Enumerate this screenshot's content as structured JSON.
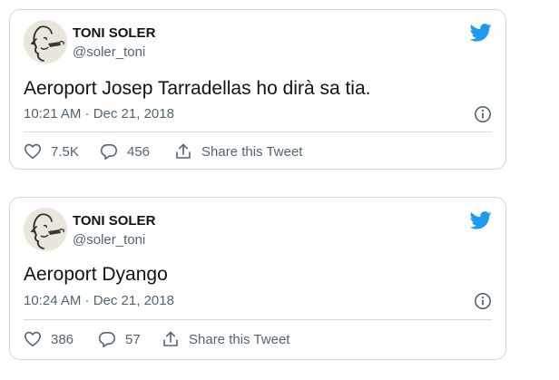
{
  "brand": {
    "accent": "#1d9bf0",
    "text": "#0f1419",
    "muted": "#536471",
    "border": "#cfd9de"
  },
  "tweets": [
    {
      "name": "TONI SOLER",
      "handle": "@soler_toni",
      "text": "Aeroport Josep Tarradellas ho dirà sa tia.",
      "timestamp": "10:21 AM · Dec 21, 2018",
      "likes": "7.5K",
      "replies": "456",
      "share_label": "Share this Tweet"
    },
    {
      "name": "TONI SOLER",
      "handle": "@soler_toni",
      "text": "Aeroport Dyango",
      "timestamp": "10:24 AM · Dec 21, 2018",
      "likes": "386",
      "replies": "57",
      "share_label": "Share this Tweet"
    }
  ],
  "icons": {
    "bird": "twitter-bird-icon",
    "info": "info-icon",
    "like": "heart-icon",
    "reply": "reply-bubble-icon",
    "share": "share-icon"
  }
}
